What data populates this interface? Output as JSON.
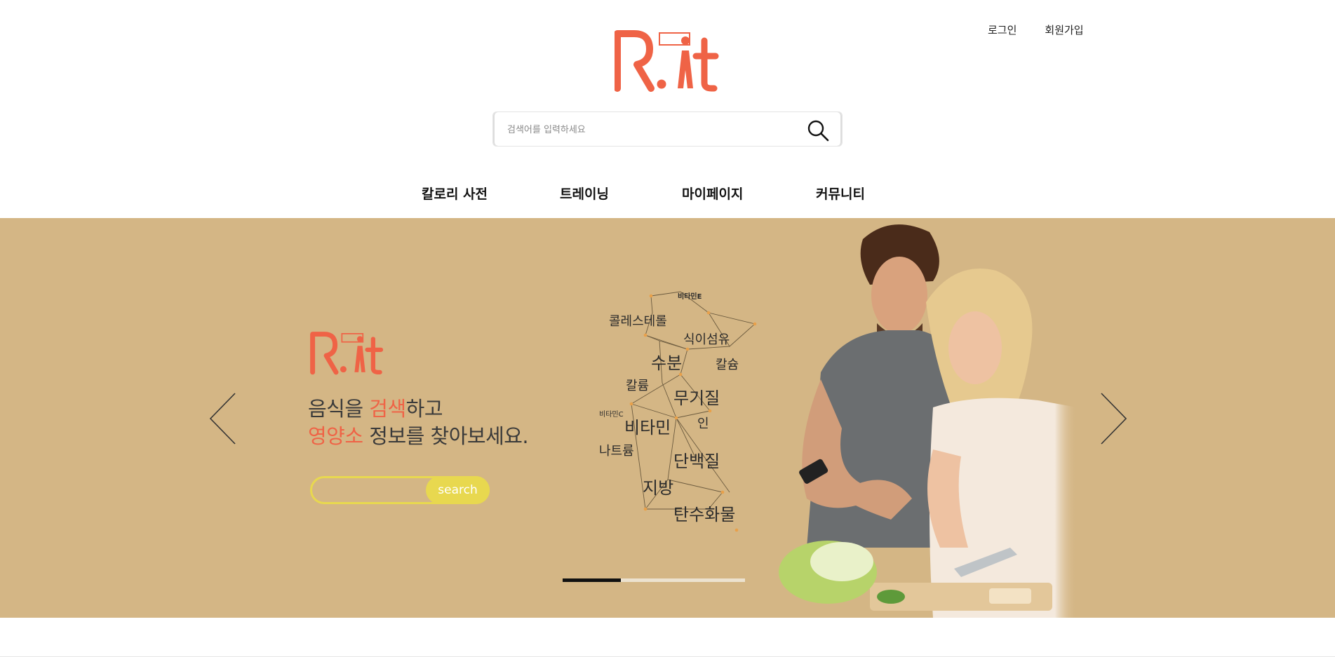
{
  "header": {
    "logo_text": "R.it",
    "links": {
      "login": "로그인",
      "signup": "회원가입"
    },
    "search": {
      "placeholder": "검색어를 입력하세요"
    }
  },
  "nav": {
    "items": [
      {
        "label": "칼로리 사전"
      },
      {
        "label": "트레이닝"
      },
      {
        "label": "마이페이지"
      },
      {
        "label": "커뮤니티"
      }
    ]
  },
  "hero": {
    "logo_text": "R.it",
    "title_line1_part1": "음식을 ",
    "title_line1_accent": "검색",
    "title_line1_part2": "하고",
    "title_line2_accent": "영양소",
    "title_line2_part2": " 정보를 찾아보세요.",
    "search_button": "search",
    "nutrients": [
      "비타민E",
      "콜레스테롤",
      "식이섬유",
      "수분",
      "칼슘",
      "칼륨",
      "무기질",
      "비타민C",
      "비타민",
      "인",
      "나트륨",
      "단백질",
      "지방",
      "탄수화물"
    ],
    "slide_progress": 0.32
  },
  "colors": {
    "brand": "#ef6346",
    "hero_bg": "#d4b685",
    "hero_search": "#e8d84f"
  }
}
